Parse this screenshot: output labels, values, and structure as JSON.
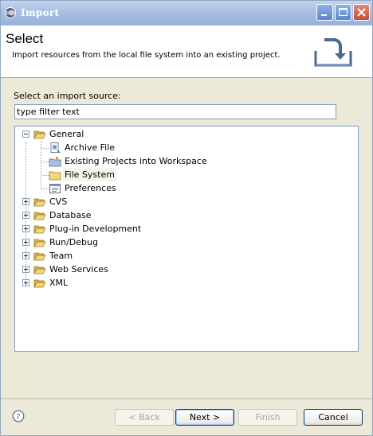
{
  "window": {
    "title": "Import",
    "app_icon": "eclipse-icon",
    "controls": [
      "minimize-icon",
      "maximize-icon",
      "close-icon"
    ]
  },
  "header": {
    "heading": "Select",
    "description": "Import resources from the local file system into an existing project.",
    "banner_icon": "import-wizard-icon"
  },
  "source": {
    "label": "Select an import source:",
    "filter_value": "type filter text"
  },
  "tree": {
    "expanded": {
      "label": "General",
      "icon": "folder-open-icon",
      "children": [
        {
          "label": "Archive File",
          "icon": "archive-file-icon"
        },
        {
          "label": "Existing Projects into Workspace",
          "icon": "existing-project-icon"
        },
        {
          "label": "File System",
          "icon": "folder-icon",
          "selected": true
        },
        {
          "label": "Preferences",
          "icon": "preferences-icon"
        }
      ]
    },
    "collapsed": [
      {
        "label": "CVS",
        "icon": "folder-icon"
      },
      {
        "label": "Database",
        "icon": "folder-icon"
      },
      {
        "label": "Plug-in Development",
        "icon": "folder-icon"
      },
      {
        "label": "Run/Debug",
        "icon": "folder-icon"
      },
      {
        "label": "Team",
        "icon": "folder-icon"
      },
      {
        "label": "Web Services",
        "icon": "folder-icon"
      },
      {
        "label": "XML",
        "icon": "folder-icon"
      }
    ]
  },
  "footer": {
    "help_icon": "help-icon",
    "back_label": "< Back",
    "next_label": "Next >",
    "finish_label": "Finish",
    "cancel_label": "Cancel"
  }
}
